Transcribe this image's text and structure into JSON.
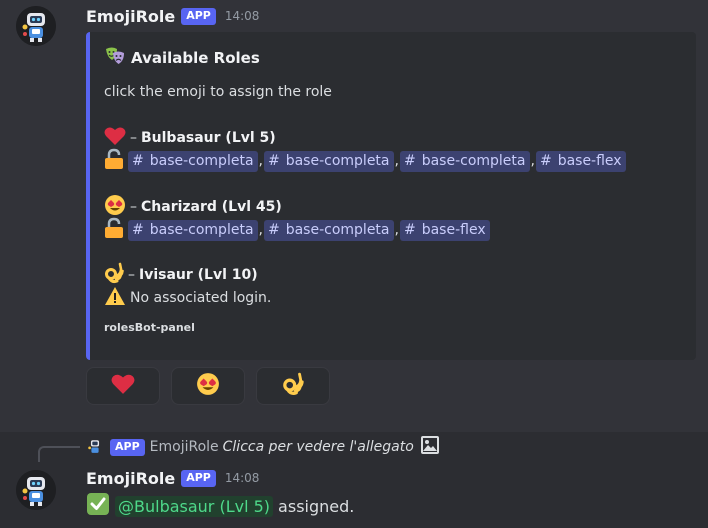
{
  "message1": {
    "username": "EmojiRole",
    "badge": "APP",
    "time": "14:08"
  },
  "embed": {
    "title": "Available Roles",
    "description": "click the emoji to assign the role",
    "accent_color": "#5865f2",
    "roles": [
      {
        "emoji": "heart",
        "name": "Bulbasaur (Lvl 5)",
        "channels": [
          "base-completa",
          "base-completa",
          "base-completa",
          "base-flex"
        ]
      },
      {
        "emoji": "heart-eyes",
        "name": "Charizard (Lvl 45)",
        "channels": [
          "base-completa",
          "base-completa",
          "base-flex"
        ]
      },
      {
        "emoji": "ok-hand",
        "name": "Ivisaur (Lvl 10)",
        "warning": "No associated login."
      }
    ],
    "dash": "–",
    "hash": "#",
    "comma": ",",
    "footer": "rolesBot-panel"
  },
  "reactions": [
    "heart",
    "heart-eyes",
    "ok-hand"
  ],
  "reply": {
    "badge": "APP",
    "username": "EmojiRole",
    "text": "Clicca per vedere l'allegato"
  },
  "message2": {
    "username": "EmojiRole",
    "badge": "APP",
    "time": "14:08",
    "mention": "@Bulbasaur (Lvl 5)",
    "text": "assigned."
  },
  "colors": {
    "background": "#323339",
    "embed_bg": "#2b2d31",
    "channel_mention_bg": "#3c4270",
    "user_mention_text": "#4ed98a"
  }
}
